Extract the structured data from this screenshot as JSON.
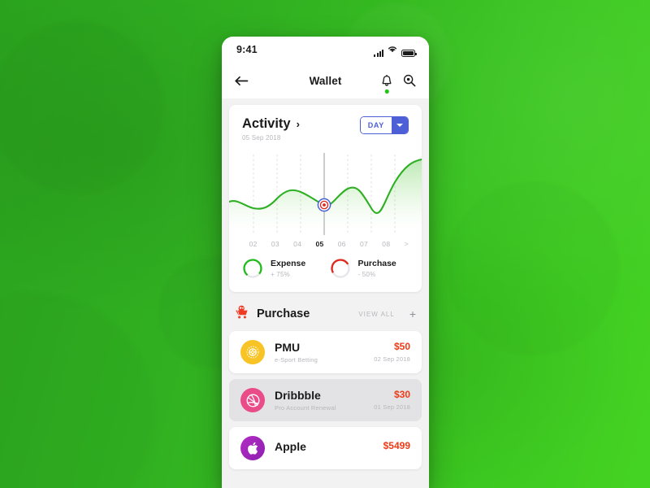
{
  "background": {
    "green_dark": "#2aa31e",
    "green_light": "#45d323"
  },
  "status_bar": {
    "time": "9:41",
    "icons": [
      "signal-bars-icon",
      "wifi-icon",
      "battery-icon"
    ]
  },
  "header": {
    "back_icon": "arrow-left-icon",
    "title": "Wallet",
    "notification_icon": "bell-icon",
    "has_notification_dot": true,
    "search_icon": "search-icon"
  },
  "activity": {
    "title": "Activity",
    "title_chevron": "chevron-right-icon",
    "date": "05 Sep 2018",
    "period": {
      "label": "DAY",
      "arrow_icon": "chevron-down-icon"
    },
    "axis": {
      "ticks": [
        "02",
        "03",
        "04",
        "05",
        "06",
        "07",
        "08"
      ],
      "active": "05",
      "more": ">"
    },
    "legend": [
      {
        "name": "Expense",
        "value": "+ 75%",
        "color": "#22bb1e",
        "percent": 75
      },
      {
        "name": "Purchase",
        "value": "- 50%",
        "color": "#e1261c",
        "percent": 50
      }
    ]
  },
  "chart_data": {
    "type": "area",
    "title": "Activity",
    "xlabel": "",
    "ylabel": "",
    "categories": [
      "02",
      "03",
      "04",
      "05",
      "06",
      "07",
      "08"
    ],
    "x": [
      1,
      2,
      3,
      4,
      5,
      6,
      7
    ],
    "values": [
      42,
      55,
      52,
      44,
      68,
      34,
      78
    ],
    "series": [
      {
        "name": "Activity",
        "values": [
          42,
          55,
          52,
          44,
          68,
          34,
          78
        ],
        "color": "#2fb024"
      }
    ],
    "ylim": [
      0,
      100
    ],
    "grid": true,
    "grid_style": "dashed-vertical",
    "legend_position": "below-chart",
    "marker": {
      "x": "05",
      "value": 44,
      "icon": "target-marker",
      "ring_color": "#4c5fd7",
      "center_color": "#e1261c"
    },
    "line_color": "#2fb024",
    "fill": "gradient-green-fade"
  },
  "purchase": {
    "icon": "shopping-cart-icon",
    "title": "Purchase",
    "view_all": "VIEW ALL",
    "add_icon": "plus-icon",
    "items": [
      {
        "name": "PMU",
        "subtitle": "e-Sport Betting",
        "amount": "$50",
        "date": "02 Sep 2018",
        "icon": "pmu-logo-icon",
        "avatar_color": "#f7c325",
        "amount_color": "#f03a17",
        "selected": false
      },
      {
        "name": "Dribbble",
        "subtitle": "Pro Account Renewal",
        "amount": "$30",
        "date": "01 Sep 2018",
        "icon": "dribbble-logo-icon",
        "avatar_color": "#ea4c89",
        "amount_color": "#f03a17",
        "selected": true
      },
      {
        "name": "Apple",
        "subtitle": "",
        "amount": "$5499",
        "date": "",
        "icon": "apple-logo-icon",
        "avatar_color": "#9c2bb8",
        "amount_color": "#f03a17",
        "selected": false
      }
    ]
  }
}
